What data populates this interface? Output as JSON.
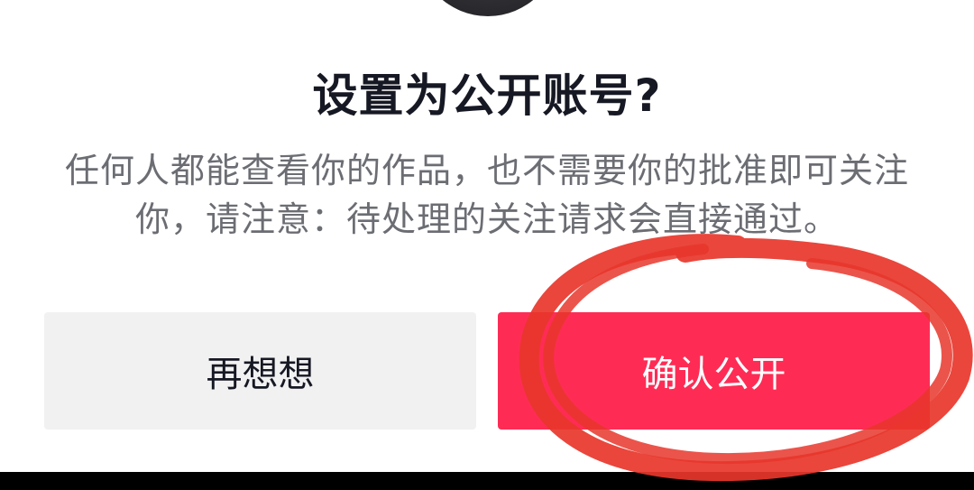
{
  "dialog": {
    "title": "设置为公开账号?",
    "description": "任何人都能查看你的作品，也不需要你的批准即可关注你，请注意：待处理的关注请求会直接通过。",
    "cancel_label": "再想想",
    "confirm_label": "确认公开"
  },
  "colors": {
    "accent": "#fe2c55",
    "annotation": "#e8362b"
  }
}
